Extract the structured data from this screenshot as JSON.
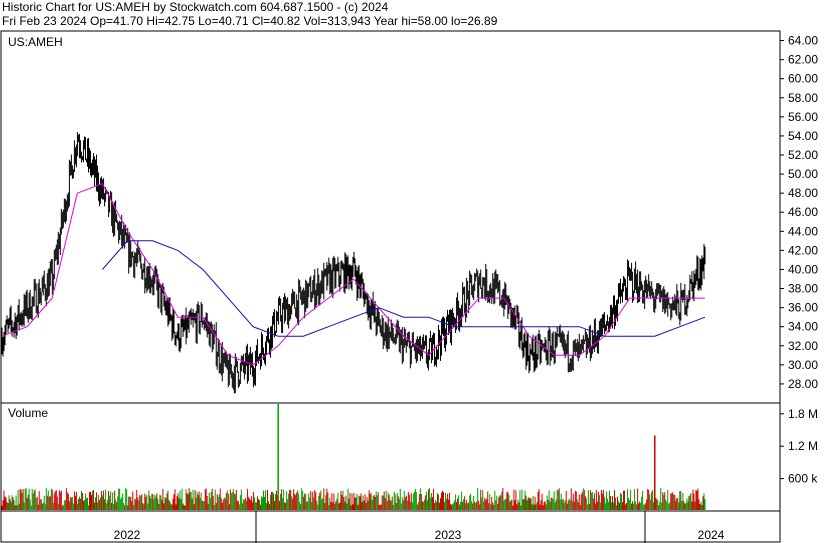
{
  "header": {
    "line1": "Historic Chart for US:AMEH by Stockwatch.com 604.687.1500 - (c) 2024",
    "line2": "Fri Feb 23 2024   Op=41.70   Hi=42.75   Lo=40.71   Cl=40.82   Vol=313,943   Year hi=58.00   lo=26.89"
  },
  "colors": {
    "price_bars": "#000000",
    "ma_short": "#e000e0",
    "ma_long": "#1010b0",
    "volume_up": "#00a000",
    "volume_down": "#d00000",
    "border": "#000000"
  },
  "chart_data": [
    {
      "type": "line",
      "title": "US:AMEH",
      "y_ticks": [
        "64.00",
        "62.00",
        "60.00",
        "58.00",
        "56.00",
        "54.00",
        "52.00",
        "50.00",
        "48.00",
        "46.00",
        "44.00",
        "42.00",
        "40.00",
        "38.00",
        "36.00",
        "34.00",
        "32.00",
        "30.00",
        "28.00"
      ],
      "ylim": [
        26,
        65
      ],
      "x_ticks": [
        "2022",
        "2023",
        "2024"
      ],
      "ohlc_note": "daily high-low bars",
      "series": [
        {
          "kind": "price",
          "x": [
            "2021-10",
            "2021-11",
            "2021-12",
            "2022-01",
            "2022-02",
            "2022-03",
            "2022-04",
            "2022-05",
            "2022-06",
            "2022-07",
            "2022-08",
            "2022-09",
            "2022-10",
            "2022-11",
            "2022-12",
            "2023-01",
            "2023-02",
            "2023-03",
            "2023-04",
            "2023-05",
            "2023-06",
            "2023-07",
            "2023-08",
            "2023-09",
            "2023-10",
            "2023-11",
            "2023-12",
            "2024-01",
            "2024-02"
          ],
          "values": [
            33,
            36,
            39,
            54,
            48,
            42,
            39,
            33,
            35,
            29,
            30,
            35,
            37,
            39,
            40,
            34,
            32,
            31,
            35,
            39,
            37,
            31,
            32,
            31,
            34,
            39,
            37,
            36,
            41
          ]
        },
        {
          "kind": "ma_short",
          "x": [
            "2021-10",
            "2021-11",
            "2021-12",
            "2022-01",
            "2022-02",
            "2022-03",
            "2022-04",
            "2022-05",
            "2022-06",
            "2022-07",
            "2022-08",
            "2022-09",
            "2022-10",
            "2022-11",
            "2022-12",
            "2023-01",
            "2023-02",
            "2023-03",
            "2023-04",
            "2023-05",
            "2023-06",
            "2023-07",
            "2023-08",
            "2023-09",
            "2023-10",
            "2023-11",
            "2023-12",
            "2024-01",
            "2024-02"
          ],
          "values": [
            33,
            34,
            37,
            48,
            49,
            44,
            40,
            35,
            35,
            31,
            30,
            32,
            35,
            37,
            39,
            36,
            33,
            31,
            34,
            37,
            37,
            33,
            31,
            31,
            33,
            37,
            37,
            37,
            37
          ]
        },
        {
          "kind": "ma_long",
          "x": [
            "2022-02",
            "2022-03",
            "2022-04",
            "2022-05",
            "2022-06",
            "2022-07",
            "2022-08",
            "2022-09",
            "2022-10",
            "2022-11",
            "2022-12",
            "2023-01",
            "2023-02",
            "2023-03",
            "2023-04",
            "2023-05",
            "2023-06",
            "2023-07",
            "2023-08",
            "2023-09",
            "2023-10",
            "2023-11",
            "2023-12",
            "2024-01",
            "2024-02"
          ],
          "values": [
            40,
            43,
            43,
            42,
            40,
            37,
            34,
            33,
            33,
            34,
            35,
            36,
            35,
            35,
            34,
            34,
            34,
            34,
            34,
            34,
            33,
            33,
            33,
            34,
            35
          ]
        }
      ]
    },
    {
      "type": "bar",
      "title": "Volume",
      "y_ticks": [
        "1.8 M",
        "1.2 M",
        "600 k"
      ],
      "ylim": [
        0,
        2000000
      ],
      "spikes": [
        {
          "date": "2022-09",
          "value": 2300000,
          "color": "green"
        },
        {
          "date": "2023-12",
          "value": 1400000,
          "color": "red"
        }
      ],
      "typical_value": 250000
    }
  ]
}
